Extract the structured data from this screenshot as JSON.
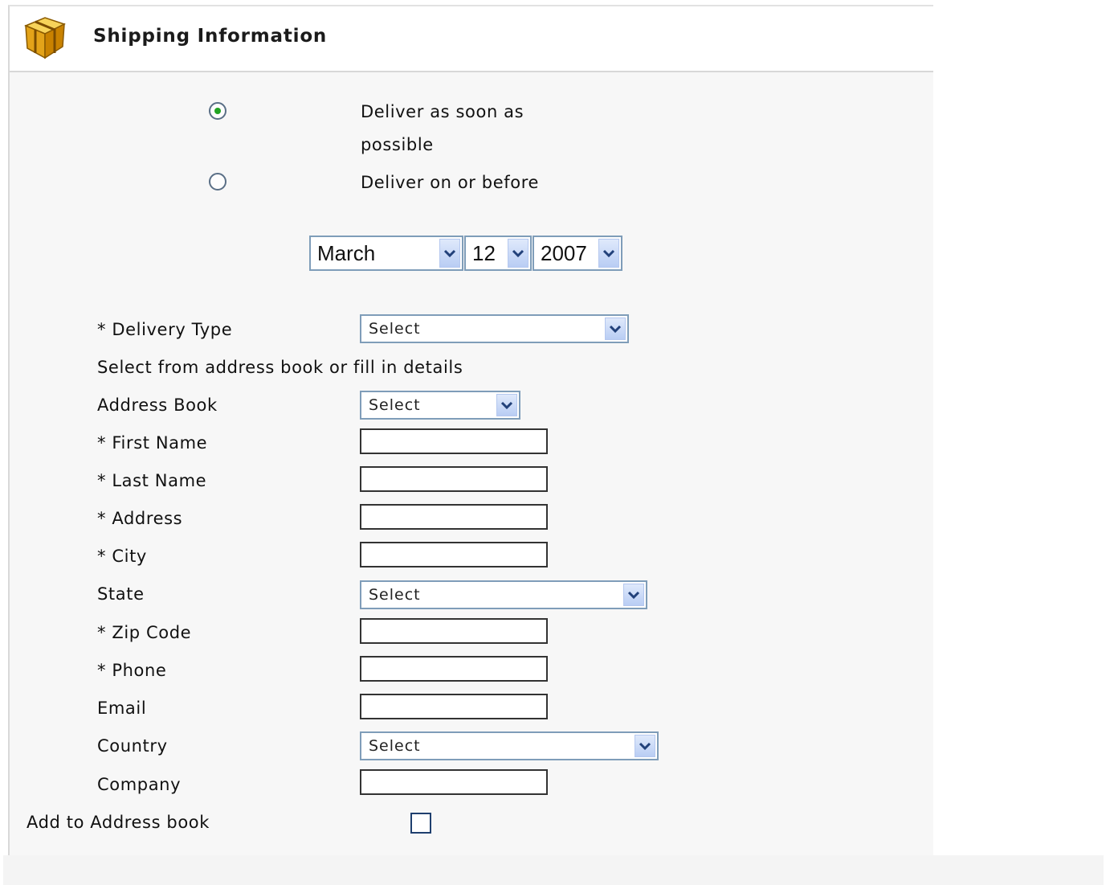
{
  "panel": {
    "title": "Shipping Information",
    "icon": "package-box-icon"
  },
  "delivery_options": [
    {
      "line1": "Deliver as soon as",
      "line2": "possible",
      "selected": true
    },
    {
      "line1": "Deliver on or before",
      "selected": false
    }
  ],
  "date": {
    "month": "March",
    "day": "12",
    "year": "2007"
  },
  "delivery_type": {
    "label": "* Delivery Type",
    "value": "Select"
  },
  "address_hint": "Select from address book or fill in details",
  "address_book": {
    "label": "Address Book",
    "value": "Select"
  },
  "fields": {
    "first_name": {
      "label": "* First Name",
      "value": ""
    },
    "last_name": {
      "label": "* Last Name",
      "value": ""
    },
    "address": {
      "label": "* Address",
      "value": ""
    },
    "city": {
      "label": "* City",
      "value": ""
    },
    "zip": {
      "label": "* Zip Code",
      "value": ""
    },
    "phone": {
      "label": "* Phone",
      "value": ""
    },
    "email": {
      "label": "Email",
      "value": ""
    },
    "company": {
      "label": "Company",
      "value": ""
    }
  },
  "state": {
    "label": "State",
    "value": "Select"
  },
  "country": {
    "label": "Country",
    "value": "Select"
  },
  "add_to_book": {
    "label": "Add to Address book",
    "checked": false
  },
  "colors": {
    "select_border": "#7f9db9",
    "radio_dot": "#22a322",
    "panel_bg": "#f7f7f7"
  }
}
